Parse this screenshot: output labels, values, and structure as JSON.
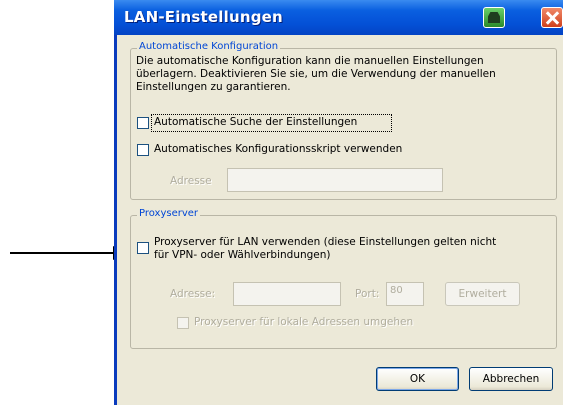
{
  "window": {
    "title": "LAN-Einstellungen",
    "titlebar_color": "#0450d6",
    "help_icon": "help-icon",
    "close_icon": "close-icon"
  },
  "auto_config": {
    "legend": "Automatische Konfiguration",
    "description": "Die automatische Konfiguration kann die manuellen Einstellungen überlagern. Deaktivieren Sie sie, um die Verwendung der manuellen Einstellungen zu garantieren.",
    "auto_detect_label": "Automatische Suche der Einstellungen",
    "auto_detect_checked": false,
    "script_label": "Automatisches Konfigurationsskript verwenden",
    "script_checked": false,
    "address_label": "Adresse",
    "address_value": ""
  },
  "proxy": {
    "legend": "Proxyserver",
    "use_proxy_label_line1": "Proxyserver für LAN verwenden (diese Einstellungen gelten nicht",
    "use_proxy_label_line2": "für VPN- oder Wählverbindungen)",
    "use_proxy_checked": false,
    "address_label": "Adresse:",
    "address_value": "",
    "port_label": "Port:",
    "port_value": "80",
    "advanced_label": "Erweitert",
    "bypass_label": "Proxyserver für lokale Adressen umgehen",
    "bypass_checked": false
  },
  "footer": {
    "ok_label": "OK",
    "cancel_label": "Abbrechen"
  }
}
